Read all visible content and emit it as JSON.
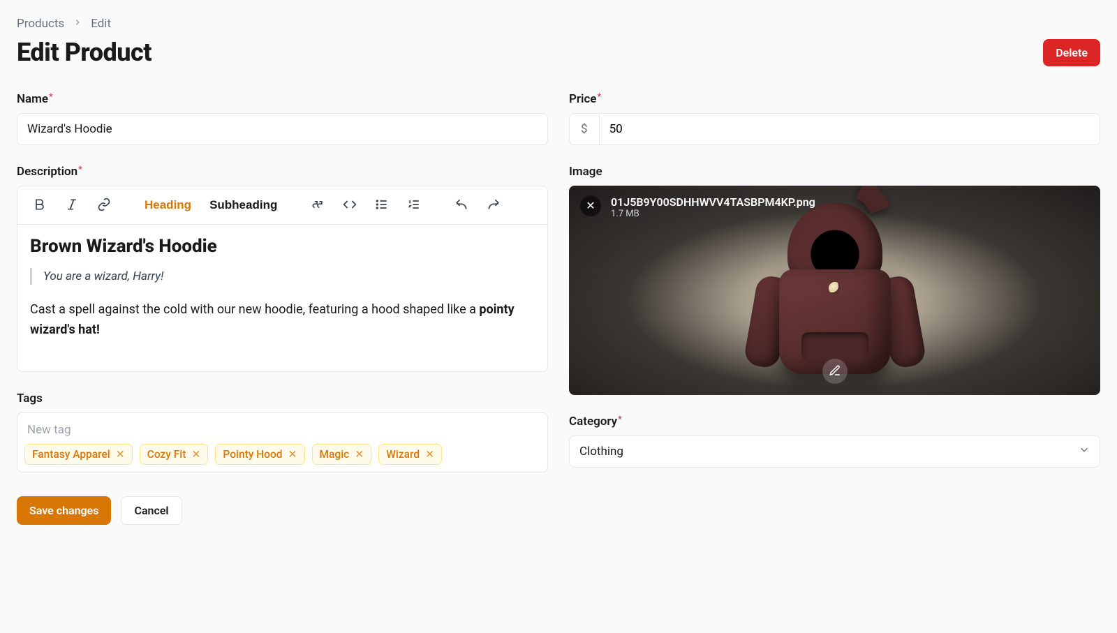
{
  "breadcrumb": {
    "root": "Products",
    "current": "Edit"
  },
  "page": {
    "title": "Edit Product"
  },
  "buttons": {
    "delete": "Delete",
    "save": "Save changes",
    "cancel": "Cancel"
  },
  "labels": {
    "name": "Name",
    "description": "Description",
    "tags": "Tags",
    "price": "Price",
    "image": "Image",
    "category": "Category"
  },
  "form": {
    "name": "Wizard's Hoodie",
    "priceCurrencySymbol": "$",
    "price": "50",
    "category": "Clothing",
    "tagPlaceholder": "New tag",
    "tags": [
      "Fantasy Apparel",
      "Cozy Fit",
      "Pointy Hood",
      "Magic",
      "Wizard"
    ]
  },
  "toolbar": {
    "heading": "Heading",
    "subheading": "Subheading",
    "active": "heading"
  },
  "description": {
    "heading": "Brown Wizard's Hoodie",
    "quote": "You are a wizard, Harry!",
    "para_prefix": "Cast a spell against the cold with our new hoodie, featuring a hood shaped like a ",
    "para_bold": "pointy wizard's hat!"
  },
  "image": {
    "filename": "01J5B9Y00SDHHWVV4TASBPM4KP.png",
    "size": "1.7 MB"
  },
  "colors": {
    "accent": "#d97706",
    "danger": "#dc2626"
  }
}
